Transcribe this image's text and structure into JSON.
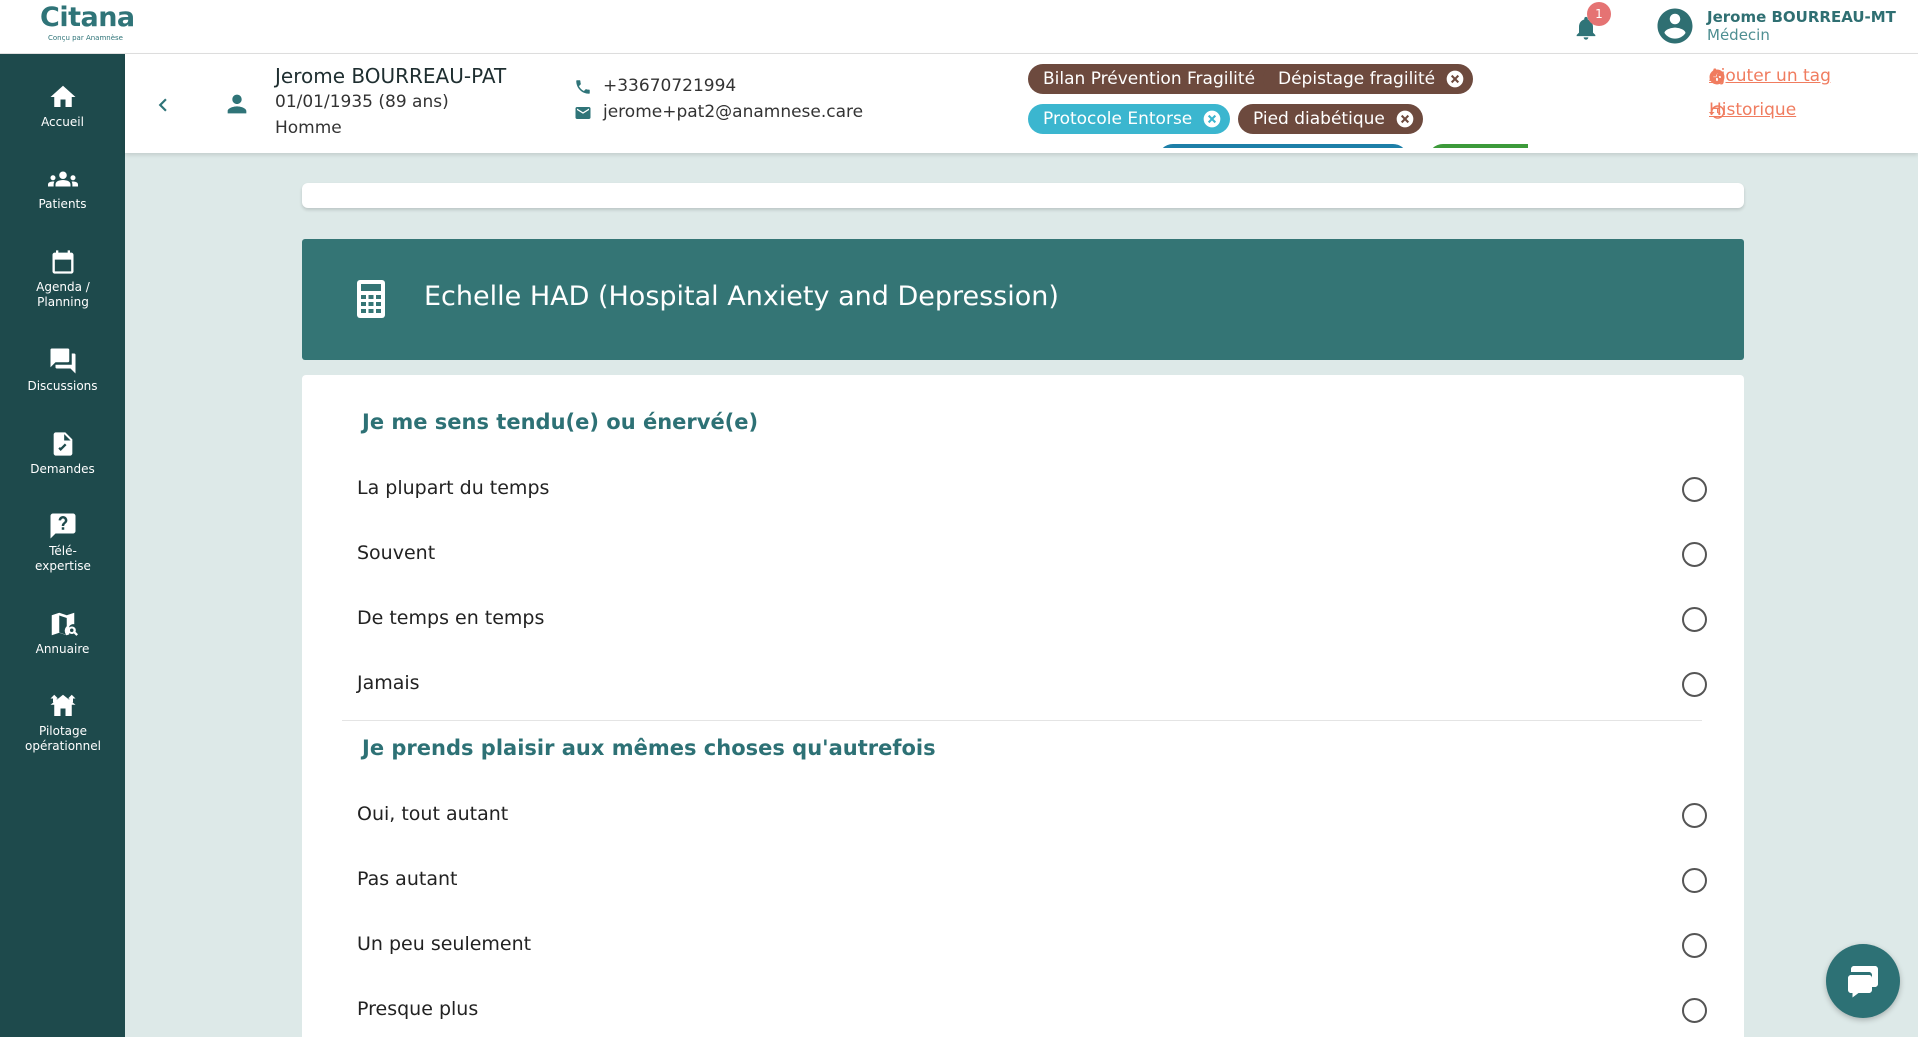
{
  "app": {
    "logo_text": "Citana",
    "logo_subtext": "Conçu par Anamnèse"
  },
  "topbar": {
    "notification_count": "1",
    "user_name": "Jerome BOURREAU-MT",
    "user_role": "Médecin"
  },
  "sidebar": {
    "items": [
      {
        "label": "Accueil",
        "icon": "home-icon"
      },
      {
        "label": "Patients",
        "icon": "group-icon"
      },
      {
        "label": "Agenda / Planning",
        "icon": "calendar-icon"
      },
      {
        "label": "Discussions",
        "icon": "chat-icon"
      },
      {
        "label": "Demandes",
        "icon": "document-icon"
      },
      {
        "label": "Télé-expertise",
        "icon": "help-icon"
      },
      {
        "label": "Annuaire",
        "icon": "map-search-icon"
      },
      {
        "label": "Pilotage opérationnel",
        "icon": "house-icon"
      }
    ]
  },
  "patient": {
    "name": "Jerome BOURREAU-PAT",
    "dob": "01/01/1935 (89 ans)",
    "sex": "Homme",
    "phone": "+33670721994",
    "email": "jerome+pat2@anamnese.care"
  },
  "tags": [
    {
      "label": "Bilan Prévention Fragilité",
      "color": "#6d4a3e"
    },
    {
      "label": "Dépistage fragilité",
      "color": "#6d4a3e"
    },
    {
      "label": "Protocole Entorse",
      "color": "#3bb6cf"
    },
    {
      "label": "Pied diabétique",
      "color": "#6d4a3e"
    }
  ],
  "actions": {
    "add_tag": "Ajouter un tag",
    "history": "Historique"
  },
  "form": {
    "title": "Echelle HAD (Hospital Anxiety and Depression)",
    "questions": [
      {
        "title": "Je me sens tendu(e) ou énervé(e)",
        "options": [
          "La plupart du temps",
          "Souvent",
          "De temps en temps",
          "Jamais"
        ]
      },
      {
        "title": "Je prends plaisir aux mêmes choses qu'autrefois",
        "options": [
          "Oui, tout autant",
          "Pas autant",
          "Un peu seulement",
          "Presque plus"
        ]
      }
    ]
  },
  "colors": {
    "primary": "#2f7478",
    "sidebar": "#1e4a4c",
    "accent": "#f07c5f",
    "background": "#dde9e8"
  }
}
